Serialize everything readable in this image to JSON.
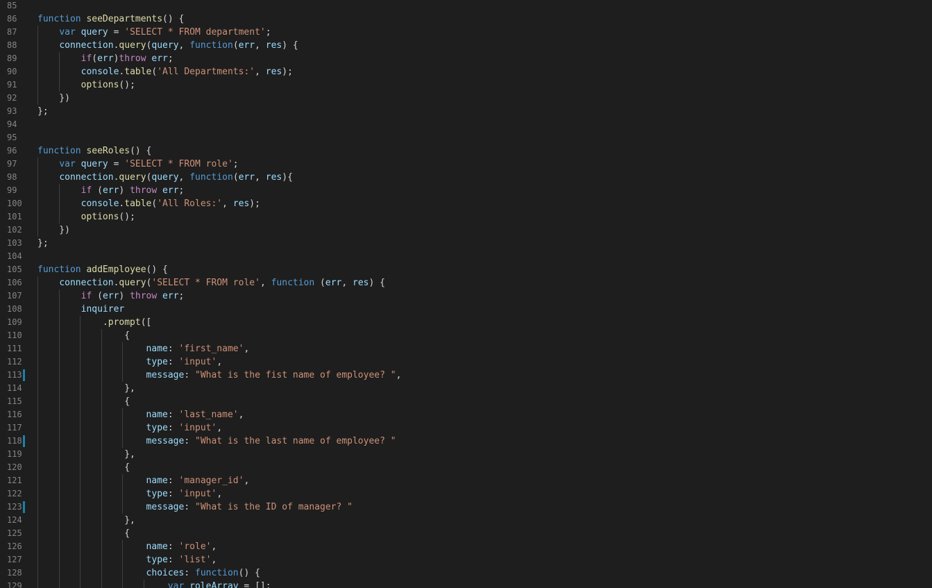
{
  "editor": {
    "colors": {
      "background": "#1e1e1e",
      "line_number": "#858585",
      "keyword": "#569cd6",
      "control": "#c586c0",
      "function": "#dcdcaa",
      "variable": "#9cdcfe",
      "string": "#ce9178",
      "punctuation": "#d4d4d4",
      "modified_marker": "#1b81a8"
    },
    "lines": [
      {
        "n": "85",
        "indent": 0,
        "modified": false,
        "tokens": []
      },
      {
        "n": "86",
        "indent": 0,
        "modified": false,
        "tokens": [
          [
            "kw",
            "function"
          ],
          [
            "p",
            " "
          ],
          [
            "fn",
            "seeDepartments"
          ],
          [
            "p",
            "() {"
          ]
        ]
      },
      {
        "n": "87",
        "indent": 1,
        "modified": false,
        "tokens": [
          [
            "p",
            "    "
          ],
          [
            "kw",
            "var"
          ],
          [
            "p",
            " "
          ],
          [
            "var",
            "query"
          ],
          [
            "p",
            " = "
          ],
          [
            "str",
            "'SELECT * FROM department'"
          ],
          [
            "p",
            ";"
          ]
        ]
      },
      {
        "n": "88",
        "indent": 1,
        "modified": false,
        "tokens": [
          [
            "p",
            "    "
          ],
          [
            "var",
            "connection"
          ],
          [
            "p",
            "."
          ],
          [
            "fn",
            "query"
          ],
          [
            "p",
            "("
          ],
          [
            "var",
            "query"
          ],
          [
            "p",
            ", "
          ],
          [
            "kw",
            "function"
          ],
          [
            "p",
            "("
          ],
          [
            "var",
            "err"
          ],
          [
            "p",
            ", "
          ],
          [
            "var",
            "res"
          ],
          [
            "p",
            ") {"
          ]
        ]
      },
      {
        "n": "89",
        "indent": 2,
        "modified": false,
        "tokens": [
          [
            "p",
            "        "
          ],
          [
            "ctl",
            "if"
          ],
          [
            "p",
            "("
          ],
          [
            "var",
            "err"
          ],
          [
            "p",
            ")"
          ],
          [
            "ctl",
            "throw"
          ],
          [
            "p",
            " "
          ],
          [
            "var",
            "err"
          ],
          [
            "p",
            ";"
          ]
        ]
      },
      {
        "n": "90",
        "indent": 2,
        "modified": false,
        "tokens": [
          [
            "p",
            "        "
          ],
          [
            "var",
            "console"
          ],
          [
            "p",
            "."
          ],
          [
            "fn",
            "table"
          ],
          [
            "p",
            "("
          ],
          [
            "str",
            "'All Departments:'"
          ],
          [
            "p",
            ", "
          ],
          [
            "var",
            "res"
          ],
          [
            "p",
            ");"
          ]
        ]
      },
      {
        "n": "91",
        "indent": 2,
        "modified": false,
        "tokens": [
          [
            "p",
            "        "
          ],
          [
            "fn",
            "options"
          ],
          [
            "p",
            "();"
          ]
        ]
      },
      {
        "n": "92",
        "indent": 1,
        "modified": false,
        "tokens": [
          [
            "p",
            "    })"
          ]
        ]
      },
      {
        "n": "93",
        "indent": 0,
        "modified": false,
        "tokens": [
          [
            "p",
            "};"
          ]
        ]
      },
      {
        "n": "94",
        "indent": 0,
        "modified": false,
        "tokens": []
      },
      {
        "n": "95",
        "indent": 0,
        "modified": false,
        "tokens": []
      },
      {
        "n": "96",
        "indent": 0,
        "modified": false,
        "tokens": [
          [
            "kw",
            "function"
          ],
          [
            "p",
            " "
          ],
          [
            "fn",
            "seeRoles"
          ],
          [
            "p",
            "() {"
          ]
        ]
      },
      {
        "n": "97",
        "indent": 1,
        "modified": false,
        "tokens": [
          [
            "p",
            "    "
          ],
          [
            "kw",
            "var"
          ],
          [
            "p",
            " "
          ],
          [
            "var",
            "query"
          ],
          [
            "p",
            " = "
          ],
          [
            "str",
            "'SELECT * FROM role'"
          ],
          [
            "p",
            ";"
          ]
        ]
      },
      {
        "n": "98",
        "indent": 1,
        "modified": false,
        "tokens": [
          [
            "p",
            "    "
          ],
          [
            "var",
            "connection"
          ],
          [
            "p",
            "."
          ],
          [
            "fn",
            "query"
          ],
          [
            "p",
            "("
          ],
          [
            "var",
            "query"
          ],
          [
            "p",
            ", "
          ],
          [
            "kw",
            "function"
          ],
          [
            "p",
            "("
          ],
          [
            "var",
            "err"
          ],
          [
            "p",
            ", "
          ],
          [
            "var",
            "res"
          ],
          [
            "p",
            "){"
          ]
        ]
      },
      {
        "n": "99",
        "indent": 2,
        "modified": false,
        "tokens": [
          [
            "p",
            "        "
          ],
          [
            "ctl",
            "if"
          ],
          [
            "p",
            " ("
          ],
          [
            "var",
            "err"
          ],
          [
            "p",
            ") "
          ],
          [
            "ctl",
            "throw"
          ],
          [
            "p",
            " "
          ],
          [
            "var",
            "err"
          ],
          [
            "p",
            ";"
          ]
        ]
      },
      {
        "n": "100",
        "indent": 2,
        "modified": false,
        "tokens": [
          [
            "p",
            "        "
          ],
          [
            "var",
            "console"
          ],
          [
            "p",
            "."
          ],
          [
            "fn",
            "table"
          ],
          [
            "p",
            "("
          ],
          [
            "str",
            "'All Roles:'"
          ],
          [
            "p",
            ", "
          ],
          [
            "var",
            "res"
          ],
          [
            "p",
            ");"
          ]
        ]
      },
      {
        "n": "101",
        "indent": 2,
        "modified": false,
        "tokens": [
          [
            "p",
            "        "
          ],
          [
            "fn",
            "options"
          ],
          [
            "p",
            "();"
          ]
        ]
      },
      {
        "n": "102",
        "indent": 1,
        "modified": false,
        "tokens": [
          [
            "p",
            "    })"
          ]
        ]
      },
      {
        "n": "103",
        "indent": 0,
        "modified": false,
        "tokens": [
          [
            "p",
            "};"
          ]
        ]
      },
      {
        "n": "104",
        "indent": 0,
        "modified": false,
        "tokens": []
      },
      {
        "n": "105",
        "indent": 0,
        "modified": false,
        "tokens": [
          [
            "kw",
            "function"
          ],
          [
            "p",
            " "
          ],
          [
            "fn",
            "addEmployee"
          ],
          [
            "p",
            "() {"
          ]
        ]
      },
      {
        "n": "106",
        "indent": 1,
        "modified": false,
        "tokens": [
          [
            "p",
            "    "
          ],
          [
            "var",
            "connection"
          ],
          [
            "p",
            "."
          ],
          [
            "fn",
            "query"
          ],
          [
            "p",
            "("
          ],
          [
            "str",
            "'SELECT * FROM role'"
          ],
          [
            "p",
            ", "
          ],
          [
            "kw",
            "function"
          ],
          [
            "p",
            " ("
          ],
          [
            "var",
            "err"
          ],
          [
            "p",
            ", "
          ],
          [
            "var",
            "res"
          ],
          [
            "p",
            ") {"
          ]
        ]
      },
      {
        "n": "107",
        "indent": 2,
        "modified": false,
        "tokens": [
          [
            "p",
            "        "
          ],
          [
            "ctl",
            "if"
          ],
          [
            "p",
            " ("
          ],
          [
            "var",
            "err"
          ],
          [
            "p",
            ") "
          ],
          [
            "ctl",
            "throw"
          ],
          [
            "p",
            " "
          ],
          [
            "var",
            "err"
          ],
          [
            "p",
            ";"
          ]
        ]
      },
      {
        "n": "108",
        "indent": 2,
        "modified": false,
        "tokens": [
          [
            "p",
            "        "
          ],
          [
            "var",
            "inquirer"
          ]
        ]
      },
      {
        "n": "109",
        "indent": 3,
        "modified": false,
        "tokens": [
          [
            "p",
            "            ."
          ],
          [
            "fn",
            "prompt"
          ],
          [
            "p",
            "(["
          ]
        ]
      },
      {
        "n": "110",
        "indent": 4,
        "modified": false,
        "tokens": [
          [
            "p",
            "                {"
          ]
        ]
      },
      {
        "n": "111",
        "indent": 5,
        "modified": false,
        "tokens": [
          [
            "p",
            "                    "
          ],
          [
            "var",
            "name"
          ],
          [
            "p",
            ": "
          ],
          [
            "str",
            "'first_name'"
          ],
          [
            "p",
            ","
          ]
        ]
      },
      {
        "n": "112",
        "indent": 5,
        "modified": false,
        "tokens": [
          [
            "p",
            "                    "
          ],
          [
            "var",
            "type"
          ],
          [
            "p",
            ": "
          ],
          [
            "str",
            "'input'"
          ],
          [
            "p",
            ","
          ]
        ]
      },
      {
        "n": "113",
        "indent": 5,
        "modified": true,
        "tokens": [
          [
            "p",
            "                    "
          ],
          [
            "var",
            "message"
          ],
          [
            "p",
            ": "
          ],
          [
            "str",
            "\"What is the fist name of employee? \""
          ],
          [
            "p",
            ","
          ]
        ]
      },
      {
        "n": "114",
        "indent": 4,
        "modified": false,
        "tokens": [
          [
            "p",
            "                },"
          ]
        ]
      },
      {
        "n": "115",
        "indent": 4,
        "modified": false,
        "tokens": [
          [
            "p",
            "                {"
          ]
        ]
      },
      {
        "n": "116",
        "indent": 5,
        "modified": false,
        "tokens": [
          [
            "p",
            "                    "
          ],
          [
            "var",
            "name"
          ],
          [
            "p",
            ": "
          ],
          [
            "str",
            "'last_name'"
          ],
          [
            "p",
            ","
          ]
        ]
      },
      {
        "n": "117",
        "indent": 5,
        "modified": false,
        "tokens": [
          [
            "p",
            "                    "
          ],
          [
            "var",
            "type"
          ],
          [
            "p",
            ": "
          ],
          [
            "str",
            "'input'"
          ],
          [
            "p",
            ","
          ]
        ]
      },
      {
        "n": "118",
        "indent": 5,
        "modified": true,
        "tokens": [
          [
            "p",
            "                    "
          ],
          [
            "var",
            "message"
          ],
          [
            "p",
            ": "
          ],
          [
            "str",
            "\"What is the last name of employee? \""
          ]
        ]
      },
      {
        "n": "119",
        "indent": 4,
        "modified": false,
        "tokens": [
          [
            "p",
            "                },"
          ]
        ]
      },
      {
        "n": "120",
        "indent": 4,
        "modified": false,
        "tokens": [
          [
            "p",
            "                {"
          ]
        ]
      },
      {
        "n": "121",
        "indent": 5,
        "modified": false,
        "tokens": [
          [
            "p",
            "                    "
          ],
          [
            "var",
            "name"
          ],
          [
            "p",
            ": "
          ],
          [
            "str",
            "'manager_id'"
          ],
          [
            "p",
            ","
          ]
        ]
      },
      {
        "n": "122",
        "indent": 5,
        "modified": false,
        "tokens": [
          [
            "p",
            "                    "
          ],
          [
            "var",
            "type"
          ],
          [
            "p",
            ": "
          ],
          [
            "str",
            "'input'"
          ],
          [
            "p",
            ","
          ]
        ]
      },
      {
        "n": "123",
        "indent": 5,
        "modified": true,
        "tokens": [
          [
            "p",
            "                    "
          ],
          [
            "var",
            "message"
          ],
          [
            "p",
            ": "
          ],
          [
            "str",
            "\"What is the ID of manager? \""
          ]
        ]
      },
      {
        "n": "124",
        "indent": 4,
        "modified": false,
        "tokens": [
          [
            "p",
            "                },"
          ]
        ]
      },
      {
        "n": "125",
        "indent": 4,
        "modified": false,
        "tokens": [
          [
            "p",
            "                {"
          ]
        ]
      },
      {
        "n": "126",
        "indent": 5,
        "modified": false,
        "tokens": [
          [
            "p",
            "                    "
          ],
          [
            "var",
            "name"
          ],
          [
            "p",
            ": "
          ],
          [
            "str",
            "'role'"
          ],
          [
            "p",
            ","
          ]
        ]
      },
      {
        "n": "127",
        "indent": 5,
        "modified": false,
        "tokens": [
          [
            "p",
            "                    "
          ],
          [
            "var",
            "type"
          ],
          [
            "p",
            ": "
          ],
          [
            "str",
            "'list'"
          ],
          [
            "p",
            ","
          ]
        ]
      },
      {
        "n": "128",
        "indent": 5,
        "modified": false,
        "tokens": [
          [
            "p",
            "                    "
          ],
          [
            "var",
            "choices"
          ],
          [
            "p",
            ": "
          ],
          [
            "kw",
            "function"
          ],
          [
            "p",
            "() {"
          ]
        ]
      },
      {
        "n": "129",
        "indent": 6,
        "modified": false,
        "tokens": [
          [
            "p",
            "                        "
          ],
          [
            "kw",
            "var"
          ],
          [
            "p",
            " "
          ],
          [
            "var",
            "roleArray"
          ],
          [
            "p",
            " = [];"
          ]
        ]
      }
    ]
  }
}
